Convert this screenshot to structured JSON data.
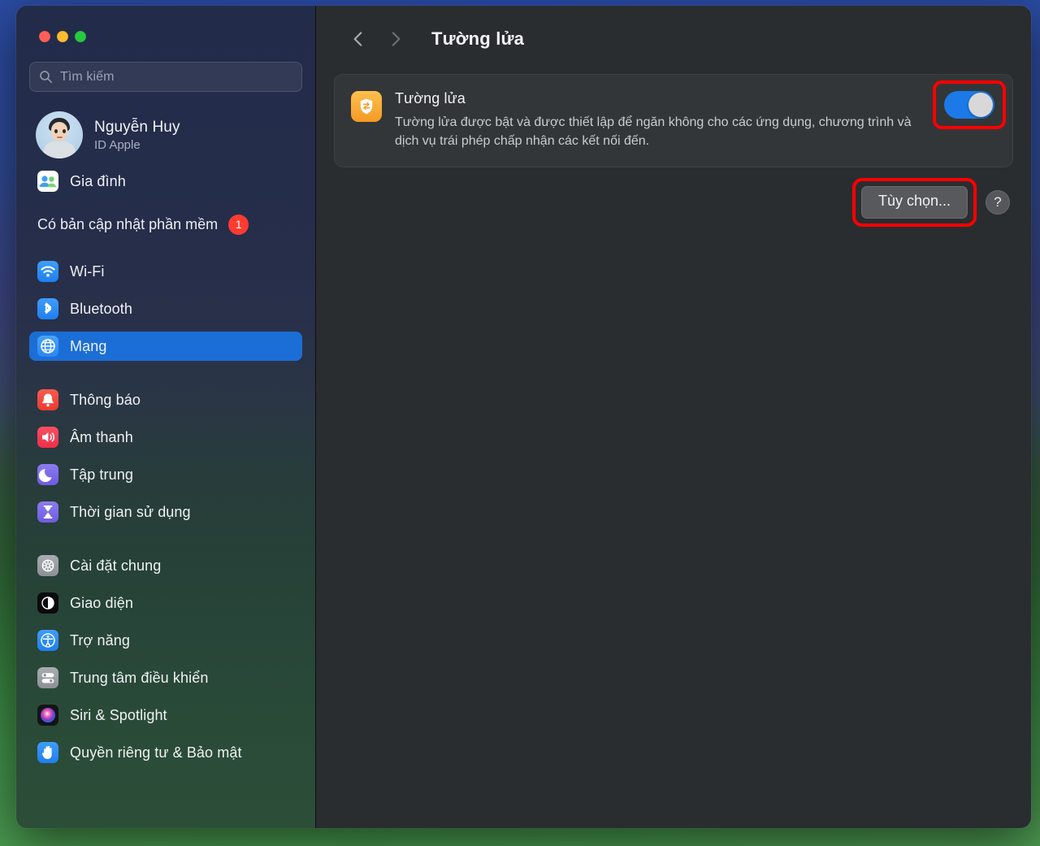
{
  "window": {
    "traffic_lights": [
      "close",
      "minimize",
      "maximize"
    ]
  },
  "sidebar": {
    "search": {
      "placeholder": "Tìm kiếm",
      "icon": "search-icon"
    },
    "account": {
      "name": "Nguyễn Huy",
      "subtitle": "ID Apple",
      "avatar": "memoji-avatar"
    },
    "family": {
      "label": "Gia đình",
      "icon": "family-icon"
    },
    "update": {
      "label": "Có bản cập nhật phần mềm",
      "badge": "1"
    },
    "groups": [
      {
        "items": [
          {
            "label": "Wi-Fi",
            "icon": "wifi-icon",
            "selected": false
          },
          {
            "label": "Bluetooth",
            "icon": "bluetooth-icon",
            "selected": false
          },
          {
            "label": "Mạng",
            "icon": "network-globe-icon",
            "selected": true
          }
        ]
      },
      {
        "items": [
          {
            "label": "Thông báo",
            "icon": "notifications-bell-icon",
            "selected": false
          },
          {
            "label": "Âm thanh",
            "icon": "sound-speaker-icon",
            "selected": false
          },
          {
            "label": "Tập trung",
            "icon": "focus-moon-icon",
            "selected": false
          },
          {
            "label": "Thời gian sử dụng",
            "icon": "screen-time-hourglass-icon",
            "selected": false
          }
        ]
      },
      {
        "items": [
          {
            "label": "Cài đặt chung",
            "icon": "general-gear-icon",
            "selected": false
          },
          {
            "label": "Giao diện",
            "icon": "appearance-contrast-icon",
            "selected": false
          },
          {
            "label": "Trợ năng",
            "icon": "accessibility-icon",
            "selected": false
          },
          {
            "label": "Trung tâm điều khiển",
            "icon": "control-center-icon",
            "selected": false
          },
          {
            "label": "Siri & Spotlight",
            "icon": "siri-icon",
            "selected": false
          },
          {
            "label": "Quyền riêng tư & Bảo mật",
            "icon": "privacy-hand-icon",
            "selected": false
          }
        ]
      }
    ]
  },
  "main": {
    "toolbar": {
      "back_icon": "chevron-left-icon",
      "forward_icon": "chevron-right-icon",
      "title": "Tường lửa"
    },
    "firewall_card": {
      "icon": "firewall-shield-icon",
      "title": "Tường lửa",
      "description": "Tường lửa được bật và được thiết lập để ngăn không cho các ứng dụng, chương trình và dịch vụ trái phép chấp nhận các kết nối đến.",
      "toggle": {
        "state": "on",
        "label": "Tường lửa toggle"
      }
    },
    "options_button": "Tùy chọn...",
    "help_button": "?"
  },
  "annotations": {
    "highlight_color": "#ff0000",
    "targets": [
      "firewall-toggle",
      "options-button"
    ]
  },
  "colors": {
    "accent_blue": "#1b79e8",
    "selected_row": "#1b6ed6",
    "badge_red": "#ff3b30",
    "panel_bg": "#2a2d30",
    "card_bg": "#333638",
    "firewall_orange": "#f59a24"
  }
}
